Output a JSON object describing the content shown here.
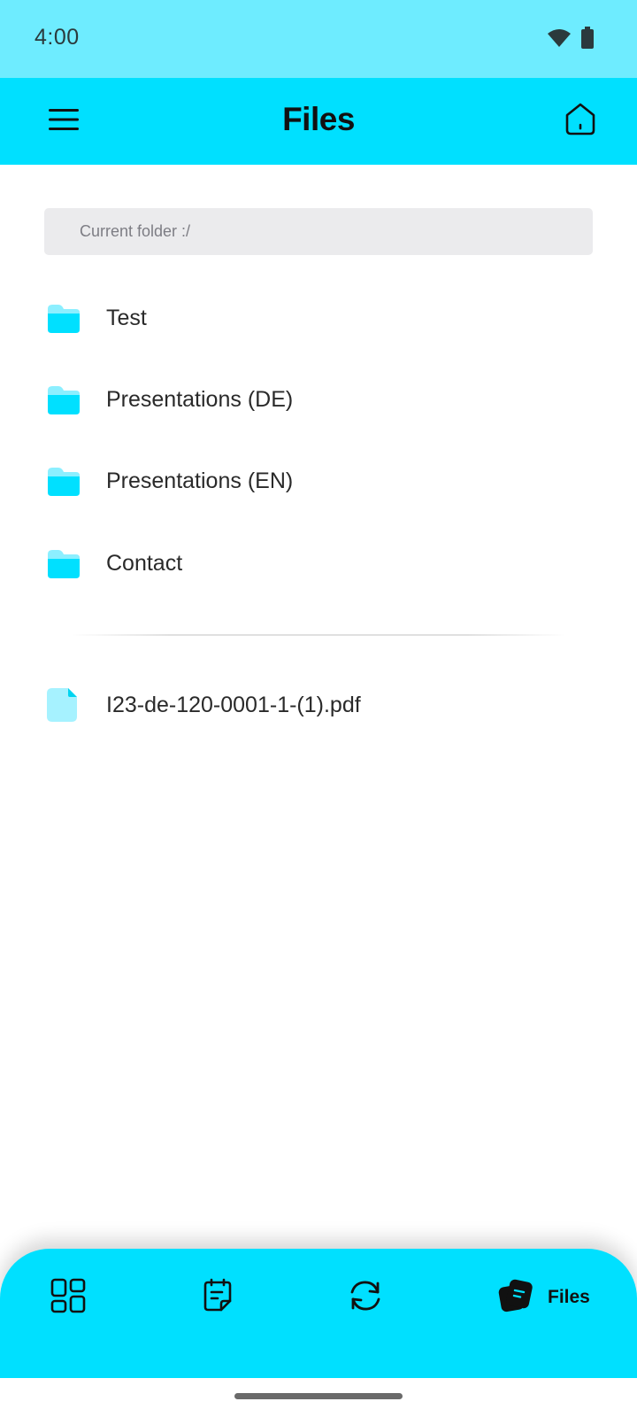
{
  "status_bar": {
    "time": "4:00",
    "icons": [
      "wifi-icon",
      "battery-icon"
    ]
  },
  "app_bar": {
    "title": "Files",
    "left_icon": "menu-icon",
    "right_icon": "home-icon"
  },
  "folder_path": {
    "text": "Current folder :/"
  },
  "folders": [
    {
      "name": "Test",
      "icon": "folder-icon"
    },
    {
      "name": "Presentations (DE)",
      "icon": "folder-icon"
    },
    {
      "name": "Presentations (EN)",
      "icon": "folder-icon"
    },
    {
      "name": "Contact",
      "icon": "folder-icon"
    }
  ],
  "files": [
    {
      "name": "I23-de-120-0001-1-(1).pdf",
      "icon": "file-icon"
    }
  ],
  "bottom_nav": {
    "items": [
      {
        "icon": "dashboard-icon",
        "label": ""
      },
      {
        "icon": "notes-icon",
        "label": ""
      },
      {
        "icon": "sync-icon",
        "label": ""
      },
      {
        "icon": "files-icon",
        "label": "Files",
        "active": true
      }
    ]
  },
  "colors": {
    "status_bar": "#6eecff",
    "accent": "#00e0ff",
    "folder_back": "#8cefff",
    "folder_front": "#00e0ff",
    "file_icon": "#a6f2ff",
    "path_bg": "#ebebed"
  }
}
